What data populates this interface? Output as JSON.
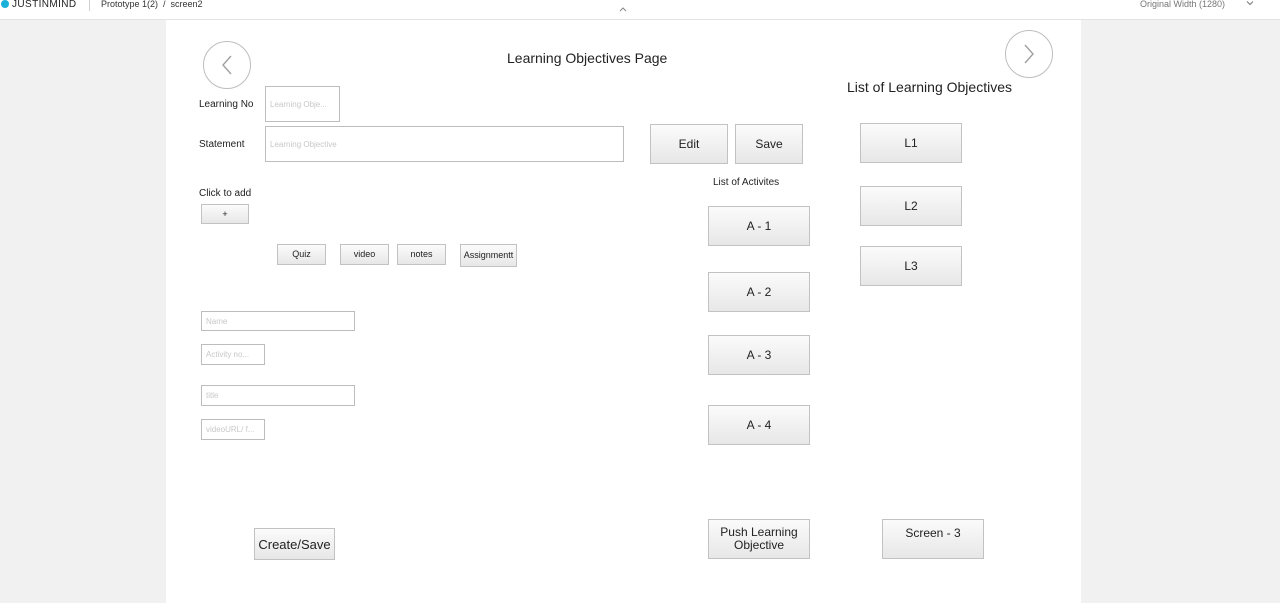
{
  "topbar": {
    "brand": "JUSTINMIND",
    "project": "Prototype 1(2)",
    "separator": "/",
    "screen": "screen2",
    "width_option": "Original Width (1280)"
  },
  "page": {
    "title": "Learning Objectives Page",
    "list_heading": "List of Learning Objectives",
    "activities_heading": "List of Activites"
  },
  "form": {
    "learning_no_label": "Learning No",
    "learning_no_placeholder": "Learning Obje...",
    "statement_label": "Statement",
    "statement_placeholder": "Learning Objective",
    "click_to_add_label": "Click to add",
    "add_button": "+",
    "edit_button": "Edit",
    "save_button": "Save"
  },
  "activity_types": {
    "quiz": "Quiz",
    "video": "video",
    "notes": "notes",
    "assignment": "Assignmentt"
  },
  "activity_form": {
    "name_placeholder": "Name",
    "activity_no_placeholder": "Activity no...",
    "title_placeholder": "title",
    "video_url_placeholder": "videoURL/ f..."
  },
  "activities": [
    "A - 1",
    "A - 2",
    "A - 3",
    "A - 4"
  ],
  "objectives": [
    "L1",
    "L2",
    "L3"
  ],
  "actions": {
    "create_save": "Create/Save",
    "push_line1": "Push Learning",
    "push_line2": "Objective",
    "screen3": "Screen - 3"
  },
  "icons": {
    "back": "chevron-left-icon",
    "next": "chevron-right-icon",
    "collapse": "chevron-up-icon",
    "dropdown": "chevron-down-icon"
  }
}
